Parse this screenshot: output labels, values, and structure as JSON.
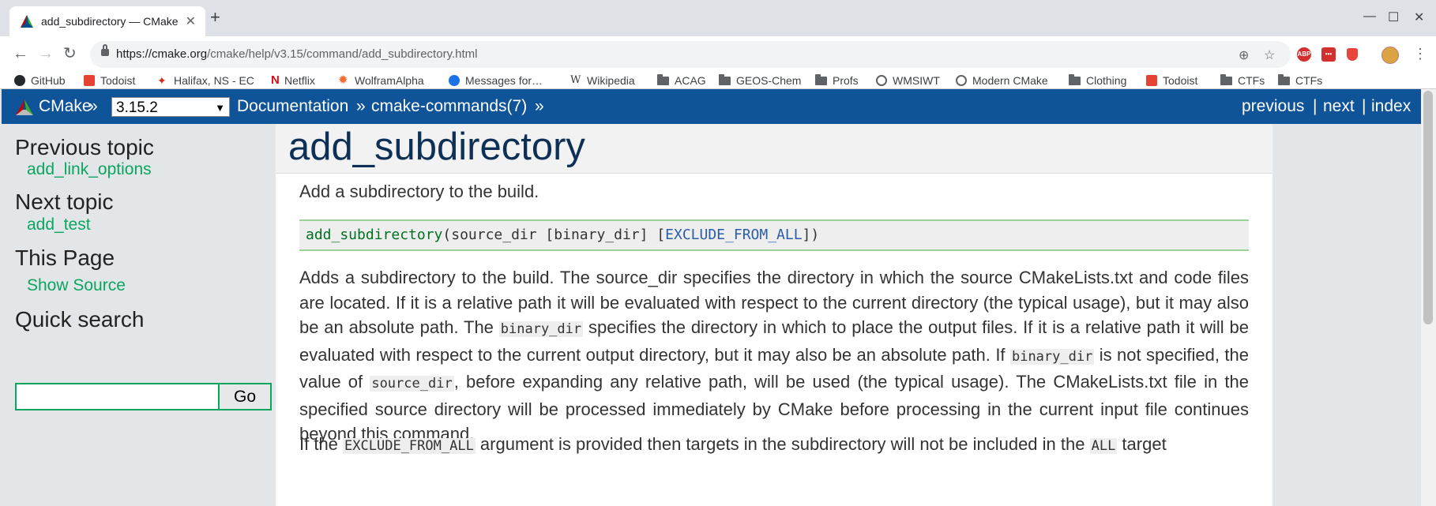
{
  "browser": {
    "tab_title": "add_subdirectory — CMake",
    "url_host": "https://cmake.org",
    "url_path": "/cmake/help/v3.15/command/add_subdirectory.html",
    "window_controls": [
      "—",
      "☐",
      "✕"
    ],
    "extensions": [
      {
        "name": "abp-icon",
        "label": "ABP",
        "color": "#d32f2f"
      },
      {
        "name": "lastpass-icon",
        "label": "•••",
        "color": "#d32f2f"
      },
      {
        "name": "shield-icon",
        "label": "",
        "color": "#e8453c"
      }
    ],
    "bookmarks": [
      {
        "label": "GitHub",
        "icon": "github-icon",
        "color": "#24292e"
      },
      {
        "label": "Todoist",
        "icon": "todoist-icon",
        "color": "#e44232"
      },
      {
        "label": "Halifax, NS - EC",
        "icon": "maple-leaf-icon",
        "color": "#d52b1e"
      },
      {
        "label": "Netflix",
        "icon": "netflix-icon",
        "color": "#e50914"
      },
      {
        "label": "WolframAlpha",
        "icon": "wolfram-icon",
        "color": "#f96932"
      },
      {
        "label": "Messages for…",
        "icon": "messages-icon",
        "color": "#1a73e8"
      },
      {
        "label": "Wikipedia",
        "icon": "wikipedia-icon",
        "color": "#333333"
      },
      {
        "label": "ACAG",
        "icon": "folder-icon",
        "color": "#5f6368"
      },
      {
        "label": "GEOS-Chem",
        "icon": "folder-icon",
        "color": "#5f6368"
      },
      {
        "label": "Profs",
        "icon": "folder-icon",
        "color": "#5f6368"
      },
      {
        "label": "WMSIWT",
        "icon": "globe-icon",
        "color": "#5f6368"
      },
      {
        "label": "Modern CMake",
        "icon": "globe-icon",
        "color": "#5f6368"
      },
      {
        "label": "Clothing",
        "icon": "folder-icon",
        "color": "#5f6368"
      },
      {
        "label": "Todoist",
        "icon": "todoist-icon",
        "color": "#e44232"
      },
      {
        "label": "CTFs",
        "icon": "folder-icon",
        "color": "#5f6368"
      },
      {
        "label": "CTFs",
        "icon": "folder-icon",
        "color": "#5f6368"
      }
    ]
  },
  "relbar": {
    "home": "CMake",
    "sep": "»",
    "version": "3.15.2",
    "documentation": "Documentation",
    "commands": "cmake-commands(7)",
    "previous": "previous",
    "next": "next",
    "index": "index",
    "pipe": "|",
    "color": "#0f5499"
  },
  "sidebar": {
    "previous_topic_heading": "Previous topic",
    "previous_topic_link": "add_link_options",
    "next_topic_heading": "Next topic",
    "next_topic_link": "add_test",
    "this_page_heading": "This Page",
    "show_source": "Show Source",
    "quick_search_heading": "Quick search",
    "search_value": "",
    "go_button": "Go",
    "link_color": "#0ba55f"
  },
  "content": {
    "title": "add_subdirectory",
    "intro": "Add a subdirectory to the build.",
    "code": {
      "fn": "add_subdirectory",
      "open": "(source_dir [binary_dir] [",
      "kw": "EXCLUDE_FROM_ALL",
      "close": "])"
    },
    "p1": [
      "Adds a subdirectory to the build. The source_dir specifies the directory in which the source CMakeLists.txt and code files are located. If it is a relative path it will be evaluated with respect to the current directory (the typical usage), but it may also be an absolute path. The ",
      "binary_dir",
      " specifies the directory in which to place the output files. If it is a relative path it will be evaluated with respect to the current output directory, but it may also be an absolute path. If ",
      "binary_dir",
      " is not specified, the value of ",
      "source_dir",
      ", before expanding any relative path, will be used (the typical usage). The CMakeLists.txt file in the specified source directory will be processed immediately by CMake before processing in the current input file continues beyond this command."
    ],
    "p2": [
      "If the ",
      "EXCLUDE_FROM_ALL",
      " argument is provided then targets in the subdirectory will not be included in the ",
      "ALL",
      " target"
    ]
  }
}
